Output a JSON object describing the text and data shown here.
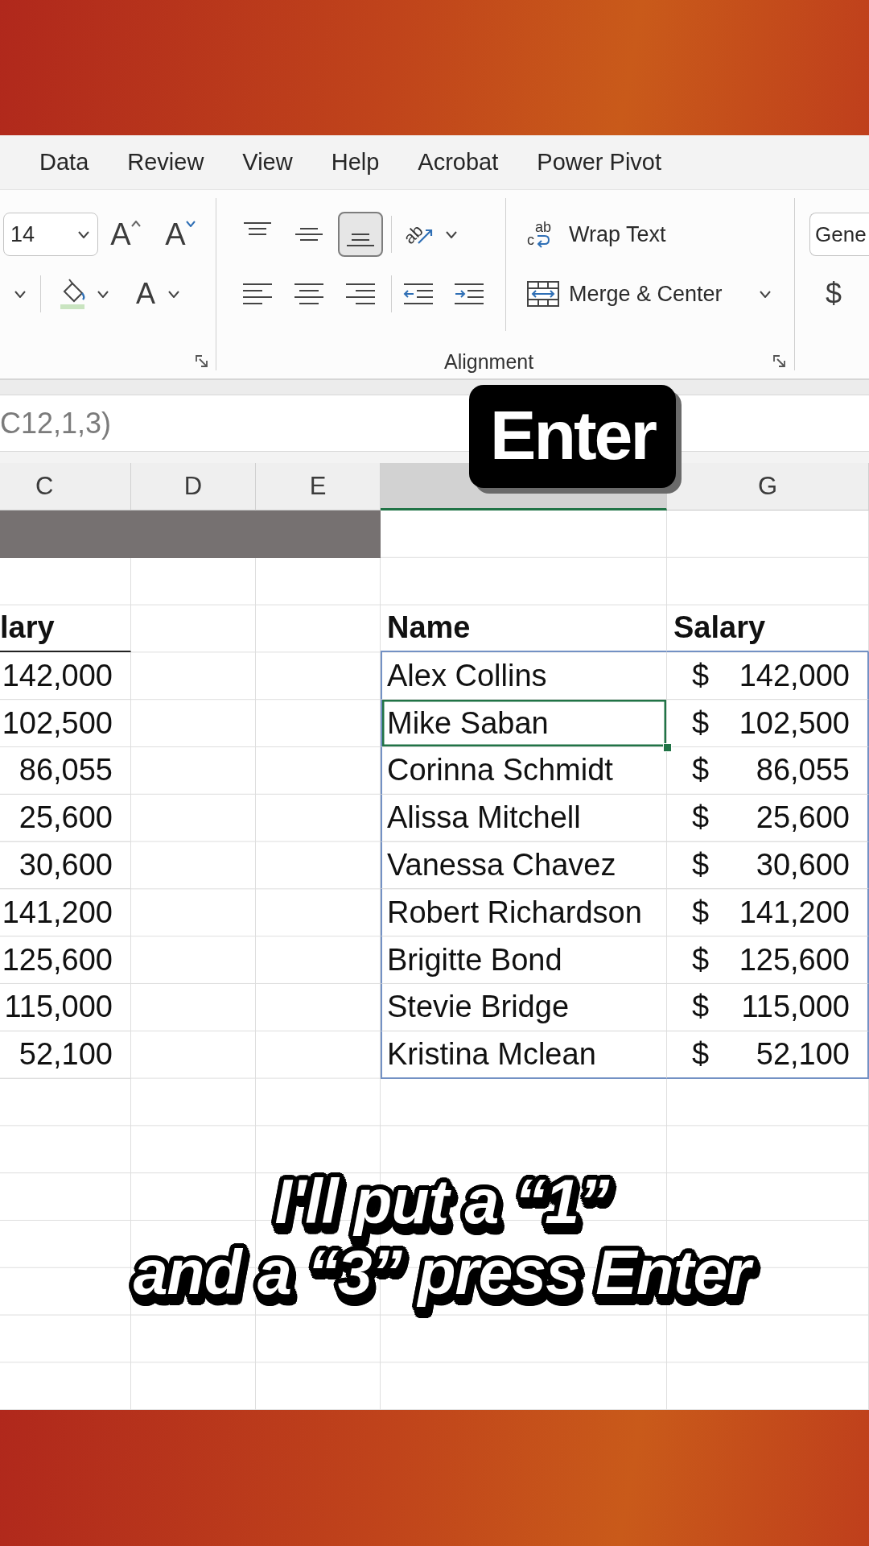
{
  "tabs": [
    {
      "label": "Data",
      "selected": false
    },
    {
      "label": "Review",
      "selected": false
    },
    {
      "label": "View",
      "selected": false
    },
    {
      "label": "Help",
      "selected": false
    },
    {
      "label": "Acrobat",
      "selected": false
    },
    {
      "label": "Power Pivot",
      "selected": false
    }
  ],
  "ribbon": {
    "font": {
      "size": "14",
      "grow_glyph": "A",
      "shrink_glyph": "A",
      "color_glyph": "A"
    },
    "alignment": {
      "title": "Alignment",
      "vertical": [
        {
          "kind": "top",
          "selected": false
        },
        {
          "kind": "middle",
          "selected": false
        },
        {
          "kind": "bottom",
          "selected": true
        }
      ],
      "horizontal": [
        {
          "kind": "left",
          "selected": false
        },
        {
          "kind": "center",
          "selected": false
        },
        {
          "kind": "right",
          "selected": false
        }
      ],
      "orientation_glyph": "ab",
      "wrap_text": {
        "label": "Wrap Text",
        "glyphs": [
          "ab",
          "c"
        ]
      },
      "merge": {
        "label": "Merge & Center"
      }
    },
    "number": {
      "format": "Gene",
      "currency_glyph": "$"
    }
  },
  "formula_bar": {
    "text": "C12,1,3)"
  },
  "sheet": {
    "columns": [
      {
        "letter": "C",
        "selected": false
      },
      {
        "letter": "D",
        "selected": false
      },
      {
        "letter": "E",
        "selected": false
      },
      {
        "selected": true
      },
      {
        "letter": "G",
        "selected": false
      }
    ],
    "left_table": {
      "heading": "lary",
      "values": [
        "142,000",
        "102,500",
        "86,055",
        "25,600",
        "30,600",
        "141,200",
        "125,600",
        "115,000",
        "52,100"
      ]
    },
    "right_table": {
      "headings": [
        "Name",
        "Salary"
      ],
      "rows": [
        {
          "name": "Alex Collins",
          "currency": "$",
          "salary": "142,000",
          "selected": false
        },
        {
          "name": "Mike Saban",
          "currency": "$",
          "salary": "102,500",
          "selected": true
        },
        {
          "name": "Corinna Schmidt",
          "currency": "$",
          "salary": "86,055",
          "selected": false
        },
        {
          "name": "Alissa Mitchell",
          "currency": "$",
          "salary": "25,600",
          "selected": false
        },
        {
          "name": "Vanessa Chavez",
          "currency": "$",
          "salary": "30,600",
          "selected": false
        },
        {
          "name": "Robert Richardson",
          "currency": "$",
          "salary": "141,200",
          "selected": false
        },
        {
          "name": "Brigitte Bond",
          "currency": "$",
          "salary": "125,600",
          "selected": false
        },
        {
          "name": "Stevie Bridge",
          "currency": "$",
          "salary": "115,000",
          "selected": false
        },
        {
          "name": "Kristina Mclean",
          "currency": "$",
          "salary": "52,100",
          "selected": false
        }
      ]
    }
  },
  "key_badge": {
    "label": "Enter"
  },
  "caption": {
    "lines": [
      "I'll put a “1”",
      "and a “3” press Enter"
    ]
  }
}
